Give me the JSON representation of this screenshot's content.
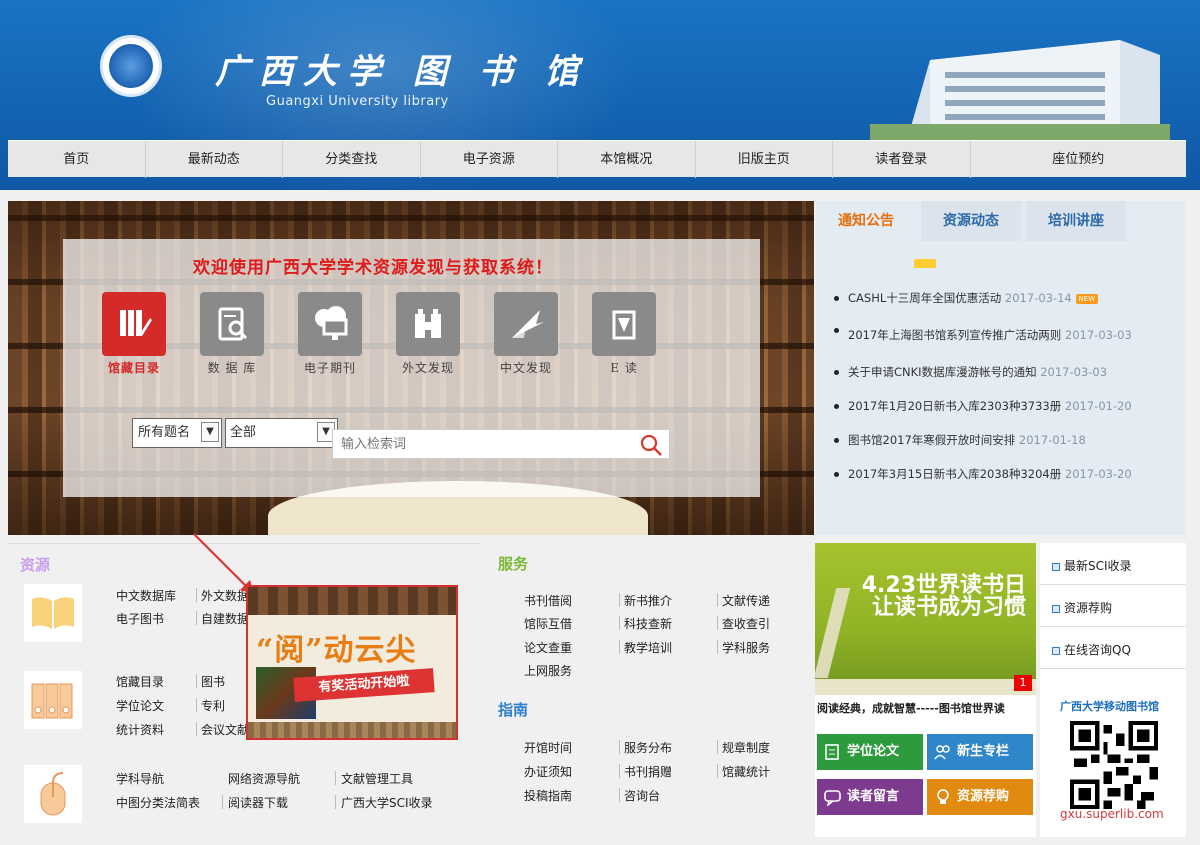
{
  "header": {
    "title": "广西大学 图 书 馆",
    "subtitle": "Guangxi University library"
  },
  "nav": [
    "首页",
    "最新动态",
    "分类查找",
    "电子资源",
    "本馆概况",
    "旧版主页",
    "读者登录",
    "座位预约"
  ],
  "hero": {
    "welcome": "欢迎使用广西大学学术资源发现与获取系统！",
    "icons": [
      "馆藏目录",
      "数 据 库",
      "电子期刊",
      "外文发现",
      "中文发现",
      "E  读"
    ],
    "select1": "所有题名",
    "select2": "全部",
    "search_placeholder": "输入检索词"
  },
  "notice": {
    "tabs": [
      "通知公告",
      "资源动态",
      "培训讲座"
    ],
    "items": [
      {
        "text": "CASHL十三周年全国优惠活动",
        "date": "2017-03-14",
        "new": "NEW"
      },
      {
        "text": "2017年上海图书馆系列宣传推广活动两则",
        "date": "2017-03-03"
      },
      {
        "text": "关于申请CNKI数据库漫游帐号的通知",
        "date": "2017-03-03"
      },
      {
        "text": "2017年1月20日新书入库2303种3733册",
        "date": "2017-01-20"
      },
      {
        "text": "图书馆2017年寒假开放时间安排",
        "date": "2017-01-18"
      },
      {
        "text": "2017年3月15日新书入库2038种3204册",
        "date": "2017-03-20"
      }
    ]
  },
  "resources": {
    "title": "资源",
    "row1": [
      "中文数据库",
      "外文数据",
      "电子图书",
      "自建数据"
    ],
    "row2": [
      "馆藏目录",
      "图书",
      "学位论文",
      "专利",
      "统计资料",
      "会议文献"
    ],
    "row3": [
      "学科导航",
      "网络资源导航",
      "文献管理工具",
      "中图分类法简表",
      "阅读器下载",
      "广西大学SCI收录"
    ]
  },
  "popup": {
    "title": "“阅”动云尖",
    "subtitle": "有奖活动开始啦"
  },
  "services": {
    "title": "服务",
    "items": [
      "书刊借阅",
      "新书推介",
      "文献传递",
      "馆际互借",
      "科技查新",
      "查收查引",
      "论文查重",
      "教学培训",
      "学科服务",
      "上网服务"
    ],
    "guide_title": "指南",
    "guide_items": [
      "开馆时间",
      "服务分布",
      "规章制度",
      "办证须知",
      "书刊捐赠",
      "馆藏统计",
      "投稿指南",
      "咨询台"
    ]
  },
  "promo": {
    "ad_line1": "4.23世界读书日",
    "ad_line2": "让读书成为习惯",
    "ad_index": "1",
    "caption": "阅读经典，成就智慧-----图书馆世界读",
    "tiles": [
      "学位论文",
      "新生专栏",
      "读者留言",
      "资源荐购"
    ],
    "tile_colors": [
      "#2e9a3e",
      "#2f86c8",
      "#7d3a8e",
      "#e08a10"
    ]
  },
  "quicklinks": [
    "最新SCI收录",
    "资源荐购",
    "在线咨询QQ"
  ],
  "mobile": {
    "title": "广西大学移动图书馆",
    "url": "gxu.superlib.com"
  }
}
